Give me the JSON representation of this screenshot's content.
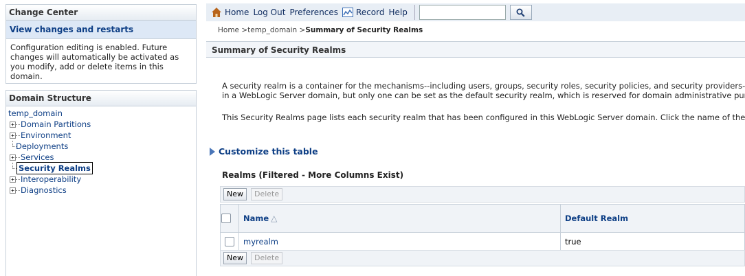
{
  "change_center": {
    "title": "Change Center",
    "subtitle": "View changes and restarts",
    "message": "Configuration editing is enabled. Future changes will automatically be activated as you modify, add or delete items in this domain."
  },
  "domain_structure": {
    "title": "Domain Structure",
    "root": "temp_domain",
    "items": [
      {
        "label": "Domain Partitions",
        "expandable": true
      },
      {
        "label": "Environment",
        "expandable": true
      },
      {
        "label": "Deployments",
        "expandable": false
      },
      {
        "label": "Services",
        "expandable": true
      },
      {
        "label": "Security Realms",
        "expandable": false,
        "selected": true
      },
      {
        "label": "Interoperability",
        "expandable": true
      },
      {
        "label": "Diagnostics",
        "expandable": true
      }
    ]
  },
  "toolbar": {
    "home": "Home",
    "logout": "Log Out",
    "preferences": "Preferences",
    "record": "Record",
    "help": "Help",
    "search_value": ""
  },
  "breadcrumb": {
    "home": "Home",
    "domain": "temp_domain",
    "current": "Summary of Security Realms"
  },
  "content": {
    "header": "Summary of Security Realms",
    "desc1": "A security realm is a container for the mechanisms--including users, groups, security roles, security policies, and security providers--that are",
    "desc2": "in a WebLogic Server domain, but only one can be set as the default security realm, which is reserved for domain administrative purposes.",
    "desc3": "This Security Realms page lists each security realm that has been configured in this WebLogic Server domain. Click the name of the realm t",
    "customize": "Customize this table",
    "table_title": "Realms (Filtered - More Columns Exist)"
  },
  "table": {
    "new_label": "New",
    "delete_label": "Delete",
    "columns": [
      "Name",
      "Default Realm"
    ],
    "rows": [
      {
        "name": "myrealm",
        "default": "true"
      }
    ]
  }
}
